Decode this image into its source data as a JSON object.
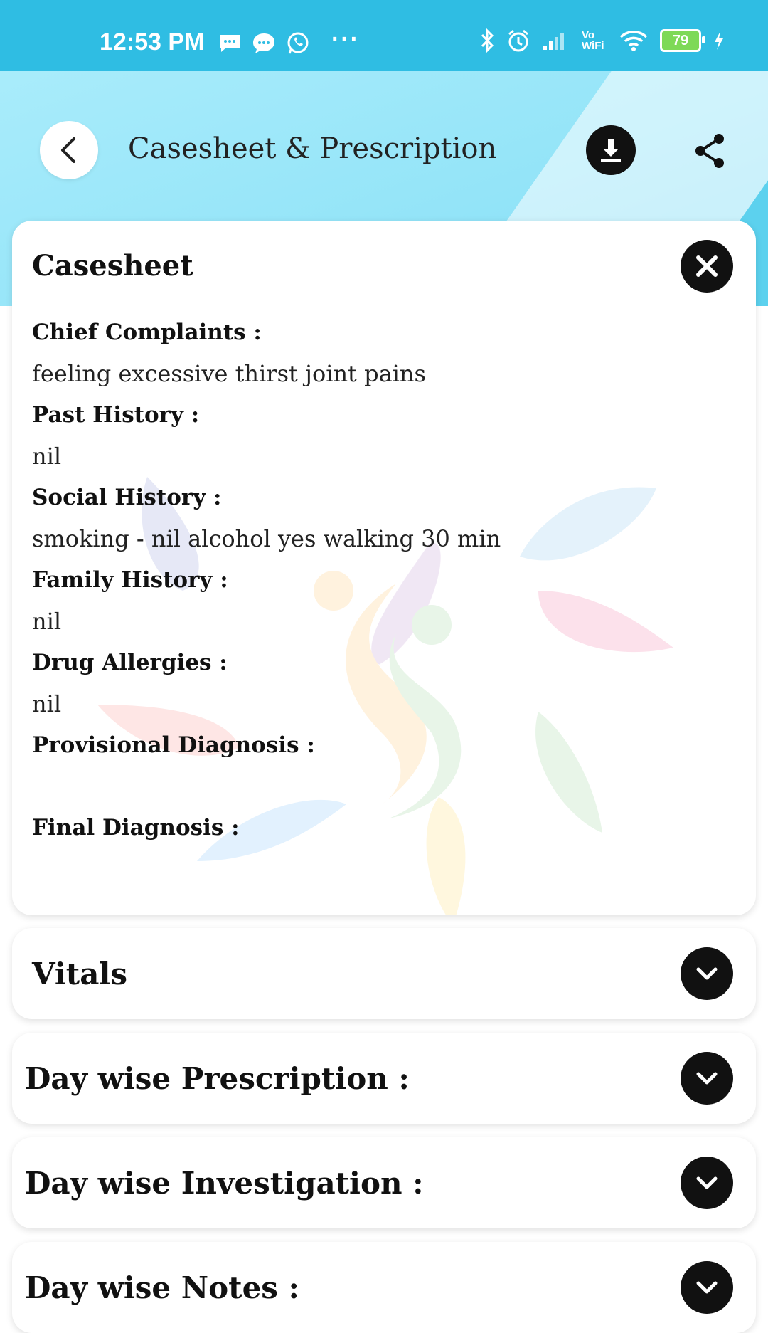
{
  "status_bar": {
    "time": "12:53 PM",
    "battery": "79",
    "network_label": "Vo WiFi"
  },
  "header": {
    "title": "Casesheet & Prescription",
    "icons": [
      "back-icon",
      "download-icon",
      "share-icon"
    ]
  },
  "casesheet": {
    "title": "Casesheet",
    "fields": [
      {
        "label": "Chief Complaints :",
        "value": "feeling excessive thirst joint pains"
      },
      {
        "label": "Past History :",
        "value": "nil"
      },
      {
        "label": "Social History :",
        "value": "smoking - nil alcohol yes walking 30 min"
      },
      {
        "label": "Family History :",
        "value": "nil"
      },
      {
        "label": "Drug Allergies :",
        "value": "nil"
      },
      {
        "label": "Provisional Diagnosis :",
        "value": ""
      },
      {
        "label": "Final Diagnosis :",
        "value": ""
      }
    ]
  },
  "sections": {
    "vitals": "Vitals",
    "day_prescription": "Day wise Prescription :",
    "day_investigation": "Day wise Investigation :",
    "day_notes": "Day wise Notes :"
  },
  "colors": {
    "status_bar": "#2fbde3",
    "header_bg": "#93e4f8",
    "button_dark": "#111111"
  }
}
